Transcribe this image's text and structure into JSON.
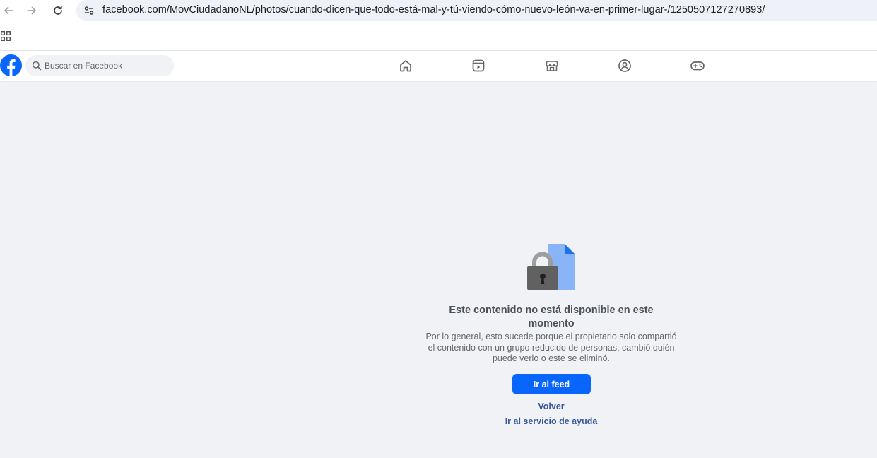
{
  "browser": {
    "back_icon": "arrow-left-icon",
    "forward_icon": "arrow-right-icon",
    "reload_icon": "reload-icon",
    "site_info_icon": "tune-icon",
    "url": "facebook.com/MovCiudadanoNL/photos/cuando-dicen-que-todo-está-mal-y-tú-viendo-cómo-nuevo-león-va-en-primer-lugar-/1250507127270893/"
  },
  "bookmarks": {
    "apps_icon": "apps-grid-icon"
  },
  "header": {
    "logo": "facebook-logo",
    "search_placeholder": "Buscar en Facebook",
    "nav": [
      "home-icon",
      "video-icon",
      "marketplace-icon",
      "groups-icon",
      "gaming-icon"
    ]
  },
  "message": {
    "illustration": "lock-document-icon",
    "heading": "Este contenido no está disponible en este momento",
    "description": "Por lo general, esto sucede porque el propietario solo compartió el contenido con un grupo reducido de personas, cambió quién puede verlo o este se eliminó.",
    "primary_button": "Ir al feed",
    "back_link": "Volver",
    "help_link": "Ir al servicio de ayuda"
  },
  "colors": {
    "fb_blue": "#0866ff",
    "link_blue": "#385898",
    "page_bg": "#f0f2f5"
  }
}
